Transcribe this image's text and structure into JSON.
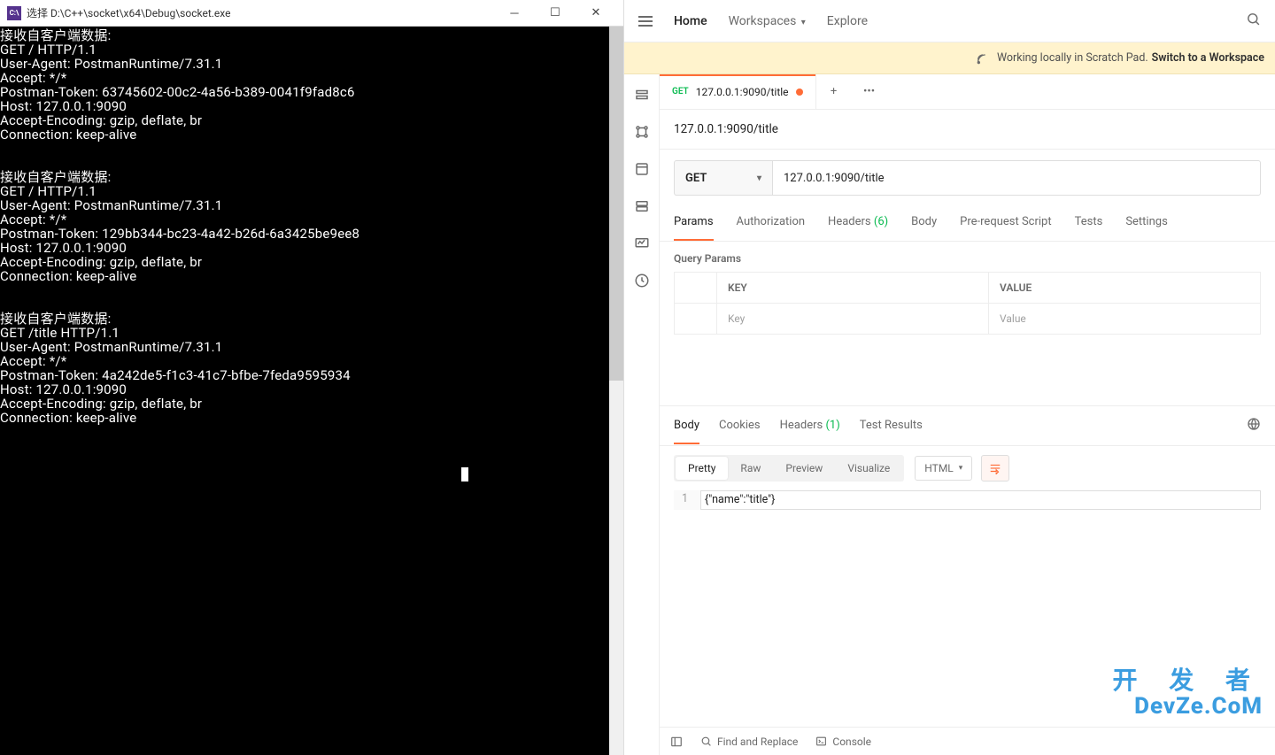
{
  "console": {
    "title": "选择 D:\\C++\\socket\\x64\\Debug\\socket.exe",
    "icon_text": "C:\\",
    "lines": [
      "接收自客户端数据:",
      "GET / HTTP/1.1",
      "User-Agent: PostmanRuntime/7.31.1",
      "Accept: */*",
      "Postman-Token: 63745602-00c2-4a56-b389-0041f9fad8c6",
      "Host: 127.0.0.1:9090",
      "Accept-Encoding: gzip, deflate, br",
      "Connection: keep-alive",
      "",
      "",
      "接收自客户端数据:",
      "GET / HTTP/1.1",
      "User-Agent: PostmanRuntime/7.31.1",
      "Accept: */*",
      "Postman-Token: 129bb344-bc23-4a42-b26d-6a3425be9ee8",
      "Host: 127.0.0.1:9090",
      "Accept-Encoding: gzip, deflate, br",
      "Connection: keep-alive",
      "",
      "",
      "接收自客户端数据:",
      "GET /title HTTP/1.1",
      "User-Agent: PostmanRuntime/7.31.1",
      "Accept: */*",
      "Postman-Token: 4a242de5-f1c3-41c7-bfbe-7feda9595934",
      "Host: 127.0.0.1:9090",
      "Accept-Encoding: gzip, deflate, br",
      "Connection: keep-alive"
    ]
  },
  "postman": {
    "nav": {
      "home": "Home",
      "workspaces": "Workspaces",
      "explore": "Explore"
    },
    "banner": {
      "text": "Working locally in Scratch Pad.",
      "link": "Switch to a Workspace"
    },
    "tab": {
      "method": "GET",
      "title": "127.0.0.1:9090/title"
    },
    "request": {
      "name": "127.0.0.1:9090/title",
      "method": "GET",
      "url": "127.0.0.1:9090/title",
      "tabs": {
        "params": "Params",
        "auth": "Authorization",
        "headers": "Headers",
        "headers_count": "(6)",
        "body": "Body",
        "prerequest": "Pre-request Script",
        "tests": "Tests",
        "settings": "Settings"
      },
      "query_params_label": "Query Params",
      "table": {
        "key_header": "KEY",
        "value_header": "VALUE",
        "key_placeholder": "Key",
        "value_placeholder": "Value"
      }
    },
    "response": {
      "tabs": {
        "body": "Body",
        "cookies": "Cookies",
        "headers": "Headers",
        "headers_count": "(1)",
        "test_results": "Test Results"
      },
      "view": {
        "pretty": "Pretty",
        "raw": "Raw",
        "preview": "Preview",
        "visualize": "Visualize"
      },
      "format": "HTML",
      "line_no": "1",
      "body_text": "{\"name\":\"title\"}"
    },
    "footer": {
      "find": "Find and Replace",
      "console": "Console"
    }
  },
  "watermark": {
    "line1": "开 发 者",
    "line2": "DevZe.CoM"
  }
}
